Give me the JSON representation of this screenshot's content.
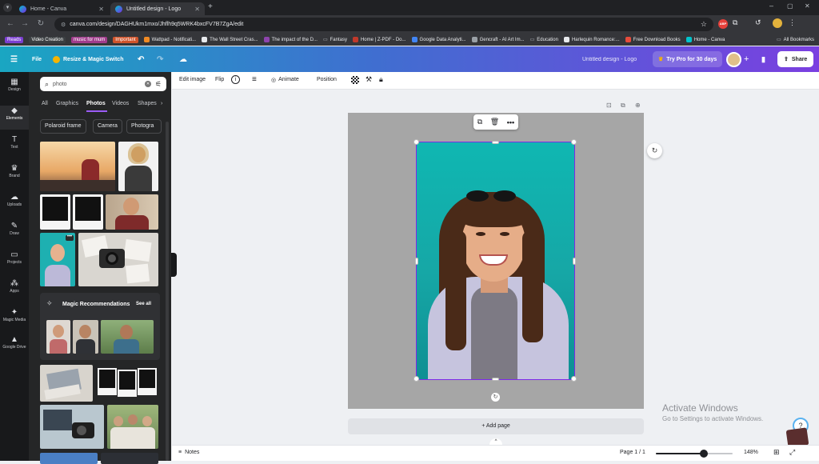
{
  "browser": {
    "tabs": [
      {
        "title": "Home - Canva",
        "active": false
      },
      {
        "title": "Untitled design - Logo",
        "active": true
      }
    ],
    "url": "canva.com/design/DAGHUkm1mxo/Jhflh9q5WRK4bxcFV7B7ZgA/edit",
    "bookmarks": [
      {
        "label": "Reads",
        "color": "#7b3fd1"
      },
      {
        "label": "Video Creation",
        "color": "#3c4043"
      },
      {
        "label": "music for mum",
        "color": "#a03c8c"
      },
      {
        "label": "Important",
        "color": "#d0542c"
      },
      {
        "label": "Wattpad - Notificati..."
      },
      {
        "label": "The Wall Street Cras..."
      },
      {
        "label": "The impact of the D..."
      },
      {
        "label": "Fantasy"
      },
      {
        "label": "Home | Z-PDF - Do..."
      },
      {
        "label": "Google Data Analyti..."
      },
      {
        "label": "Gencraft - AI Art Im..."
      },
      {
        "label": "Education"
      },
      {
        "label": "Harlequin Romance:..."
      },
      {
        "label": "Free Download Books"
      },
      {
        "label": "Home - Canva"
      }
    ],
    "all_bookmarks": "All Bookmarks"
  },
  "header": {
    "file": "File",
    "resize": "Resize & Magic Switch",
    "doc_title": "Untitled design - Logo",
    "try_pro": "Try Pro for 30 days",
    "share": "Share"
  },
  "rail": [
    {
      "label": "Design",
      "icon": "design-icon",
      "glyph": "▦"
    },
    {
      "label": "Elements",
      "icon": "elements-icon",
      "glyph": "◆",
      "active": true
    },
    {
      "label": "Text",
      "icon": "text-icon",
      "glyph": "T"
    },
    {
      "label": "Brand",
      "icon": "brand-icon",
      "glyph": "♛"
    },
    {
      "label": "Uploads",
      "icon": "uploads-icon",
      "glyph": "☁"
    },
    {
      "label": "Draw",
      "icon": "draw-icon",
      "glyph": "✎"
    },
    {
      "label": "Projects",
      "icon": "projects-icon",
      "glyph": "▭"
    },
    {
      "label": "Apps",
      "icon": "apps-icon",
      "glyph": "⁂"
    },
    {
      "label": "Magic Media",
      "icon": "magic-media-icon",
      "glyph": "✦"
    },
    {
      "label": "Google Drive",
      "icon": "google-drive-icon",
      "glyph": "▲"
    }
  ],
  "panel": {
    "search_value": "photo",
    "tabs": [
      "All",
      "Graphics",
      "Photos",
      "Videos",
      "Shapes"
    ],
    "active_tab": "Photos",
    "chips": [
      "Polaroid frame",
      "Camera",
      "Photogra"
    ],
    "magic_title": "Magic Recommendations",
    "see_all": "See all"
  },
  "toolbar": {
    "edit_image": "Edit image",
    "flip": "Flip",
    "animate": "Animate",
    "position": "Position"
  },
  "canvas": {
    "add_page": "+ Add page"
  },
  "footer": {
    "notes": "Notes",
    "page": "Page 1 / 1",
    "zoom": "148%",
    "zoom_fraction": 0.62
  },
  "watermark": {
    "title": "Activate Windows",
    "subtitle": "Go to Settings to activate Windows."
  }
}
